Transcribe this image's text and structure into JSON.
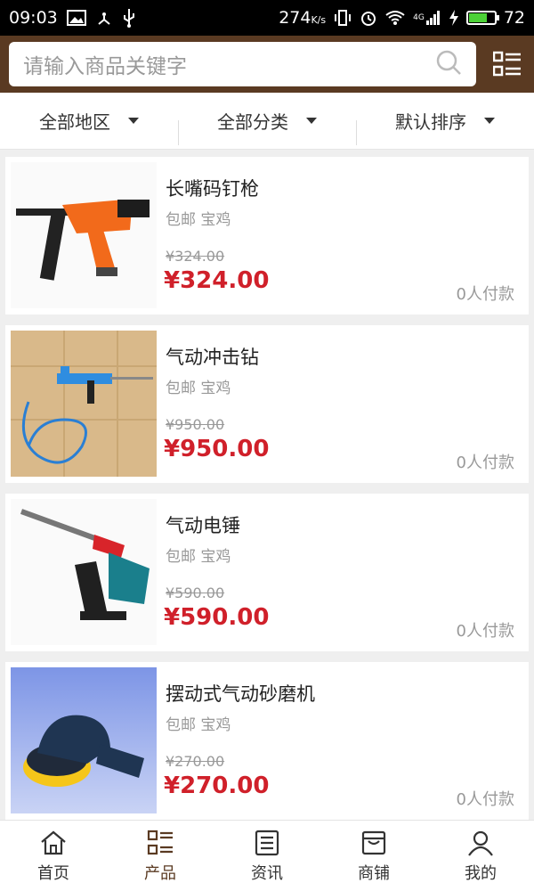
{
  "status_bar": {
    "time": "09:03",
    "speed": "274",
    "speed_unit": "K/s",
    "battery_level": "72",
    "network": "4G"
  },
  "search": {
    "placeholder": "请输入商品关键字"
  },
  "filters": [
    {
      "label": "全部地区"
    },
    {
      "label": "全部分类"
    },
    {
      "label": "默认排序"
    }
  ],
  "products": [
    {
      "name": "长嘴码钉枪",
      "shipping": "包邮 宝鸡",
      "old_price": "¥324.00",
      "price": "¥324.00",
      "paid": "0人付款",
      "image": "nail-gun"
    },
    {
      "name": "气动冲击钻",
      "shipping": "包邮 宝鸡",
      "old_price": "¥950.00",
      "price": "¥950.00",
      "paid": "0人付款",
      "image": "pneumatic-drill"
    },
    {
      "name": "气动电锤",
      "shipping": "包邮 宝鸡",
      "old_price": "¥590.00",
      "price": "¥590.00",
      "paid": "0人付款",
      "image": "rotary-hammer"
    },
    {
      "name": "摆动式气动砂磨机",
      "shipping": "包邮 宝鸡",
      "old_price": "¥270.00",
      "price": "¥270.00",
      "paid": "0人付款",
      "image": "orbital-sander"
    }
  ],
  "tabs": [
    {
      "label": "首页",
      "icon": "home-icon"
    },
    {
      "label": "产品",
      "icon": "list-icon"
    },
    {
      "label": "资讯",
      "icon": "news-icon"
    },
    {
      "label": "商铺",
      "icon": "store-icon"
    },
    {
      "label": "我的",
      "icon": "user-icon"
    }
  ],
  "colors": {
    "header": "#5a3a22",
    "price": "#d0202a",
    "active_tab": "#5a3a22"
  }
}
